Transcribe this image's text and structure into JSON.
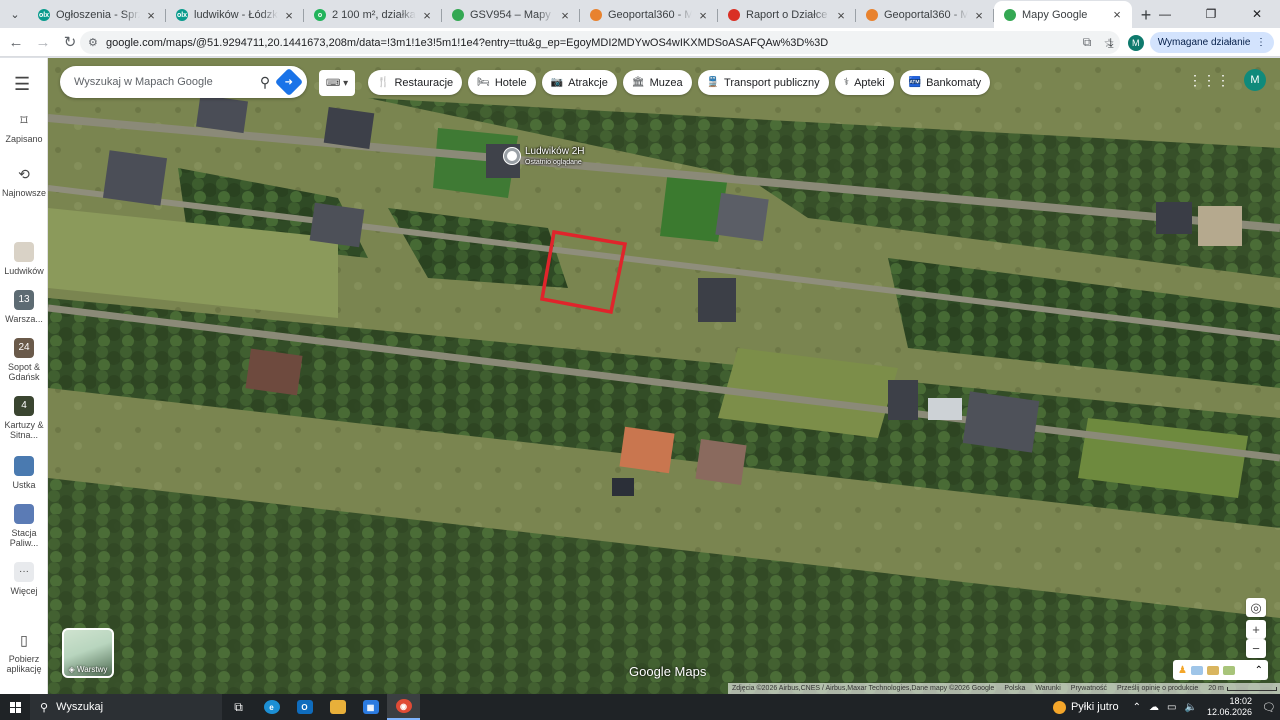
{
  "tabs": [
    {
      "title": "Ogłoszenia - Sprzedam, kupię",
      "favicon": "olx-icon",
      "color": "#0a9b8d",
      "letter": "olx"
    },
    {
      "title": "ludwików - Łódzkie - sprzedaż",
      "favicon": "olx-icon",
      "color": "#0a9b8d",
      "letter": "olx"
    },
    {
      "title": "2 100 m², działka na sprzedaż",
      "favicon": "otodom-icon",
      "color": "#21b35a",
      "letter": "o"
    },
    {
      "title": "GSV954 – Mapy Google",
      "favicon": "maps-pin-icon",
      "color": "#34a853",
      "letter": ""
    },
    {
      "title": "Geoportal360 - Mapa Interaktywna",
      "favicon": "geoportal-icon",
      "color": "#e8822e",
      "letter": ""
    },
    {
      "title": "Raport o Działce | Działki360",
      "favicon": "raport-icon",
      "color": "#d93025",
      "letter": ""
    },
    {
      "title": "Geoportal360 - Mapa Interaktywna",
      "favicon": "geoportal-icon",
      "color": "#e8822e",
      "letter": ""
    },
    {
      "title": "Mapy Google",
      "favicon": "maps-pin-icon",
      "color": "#34a853",
      "letter": "",
      "active": true
    }
  ],
  "toolbar": {
    "url": "google.com/maps/@51.9294711,20.1441673,208m/data=!3m1!1e3!5m1!1e4?entry=ttu&g_ep=EgoyMDI2MDYwOS4wIKXMDSoASAFQAw%3D%3D",
    "profile_letter": "M",
    "action_label": "Wymagane działanie"
  },
  "rail": {
    "items": [
      {
        "label": "Zapisano",
        "icon": "bookmark-icon"
      },
      {
        "label": "Najnowsze",
        "icon": "history-icon"
      },
      {
        "label": "Ludwików",
        "icon": "thumb-ludwikow",
        "badge": ""
      },
      {
        "label": "Warsza...",
        "icon": "thumb-warszawa",
        "badge": "13"
      },
      {
        "label": "Sopot & Gdańsk",
        "icon": "thumb-sopot",
        "badge": "24"
      },
      {
        "label": "Kartuzy & Sitna...",
        "icon": "thumb-kartuzy",
        "badge": "4"
      },
      {
        "label": "Ustka",
        "icon": "thumb-ustka",
        "badge": ""
      },
      {
        "label": "Stacja Paliw...",
        "icon": "thumb-stacja",
        "badge": ""
      },
      {
        "label": "Więcej",
        "icon": "more-icon",
        "badge": "···"
      },
      {
        "label": "Pobierz aplikację",
        "icon": "phone-icon",
        "badge": ""
      }
    ]
  },
  "map": {
    "search_placeholder": "Wyszukaj w Mapach Google",
    "chips": [
      {
        "label": "Restauracje",
        "icon": "restaurant-icon",
        "glyph": "🍴"
      },
      {
        "label": "Hotele",
        "icon": "hotel-icon",
        "glyph": "🛏"
      },
      {
        "label": "Atrakcje",
        "icon": "camera-icon",
        "glyph": "📷"
      },
      {
        "label": "Muzea",
        "icon": "museum-icon",
        "glyph": "🏛"
      },
      {
        "label": "Transport publiczny",
        "icon": "transit-icon",
        "glyph": "🚆"
      },
      {
        "label": "Apteki",
        "icon": "pharmacy-icon",
        "glyph": "⚕"
      },
      {
        "label": "Bankomaty",
        "icon": "atm-icon",
        "glyph": "🏧"
      }
    ],
    "account_letter": "M",
    "pin": {
      "title": "Ludwików 2H",
      "subtitle": "Ostatnio oglądane"
    },
    "layers_label": "Warstwy",
    "logo": "Google Maps",
    "attribution": "Zdjęcia ©2026 Airbus,CNES / Airbus,Maxar Technologies,Dane mapy ©2026 Google",
    "links": [
      "Polska",
      "Warunki",
      "Prywatność",
      "Prześlij opinię o produkcie"
    ],
    "scale": "20 m"
  },
  "taskbar": {
    "search_label": "Wyszukaj",
    "weather": "Pyłki jutro",
    "time": "18:02",
    "date": "12.06.2026"
  }
}
